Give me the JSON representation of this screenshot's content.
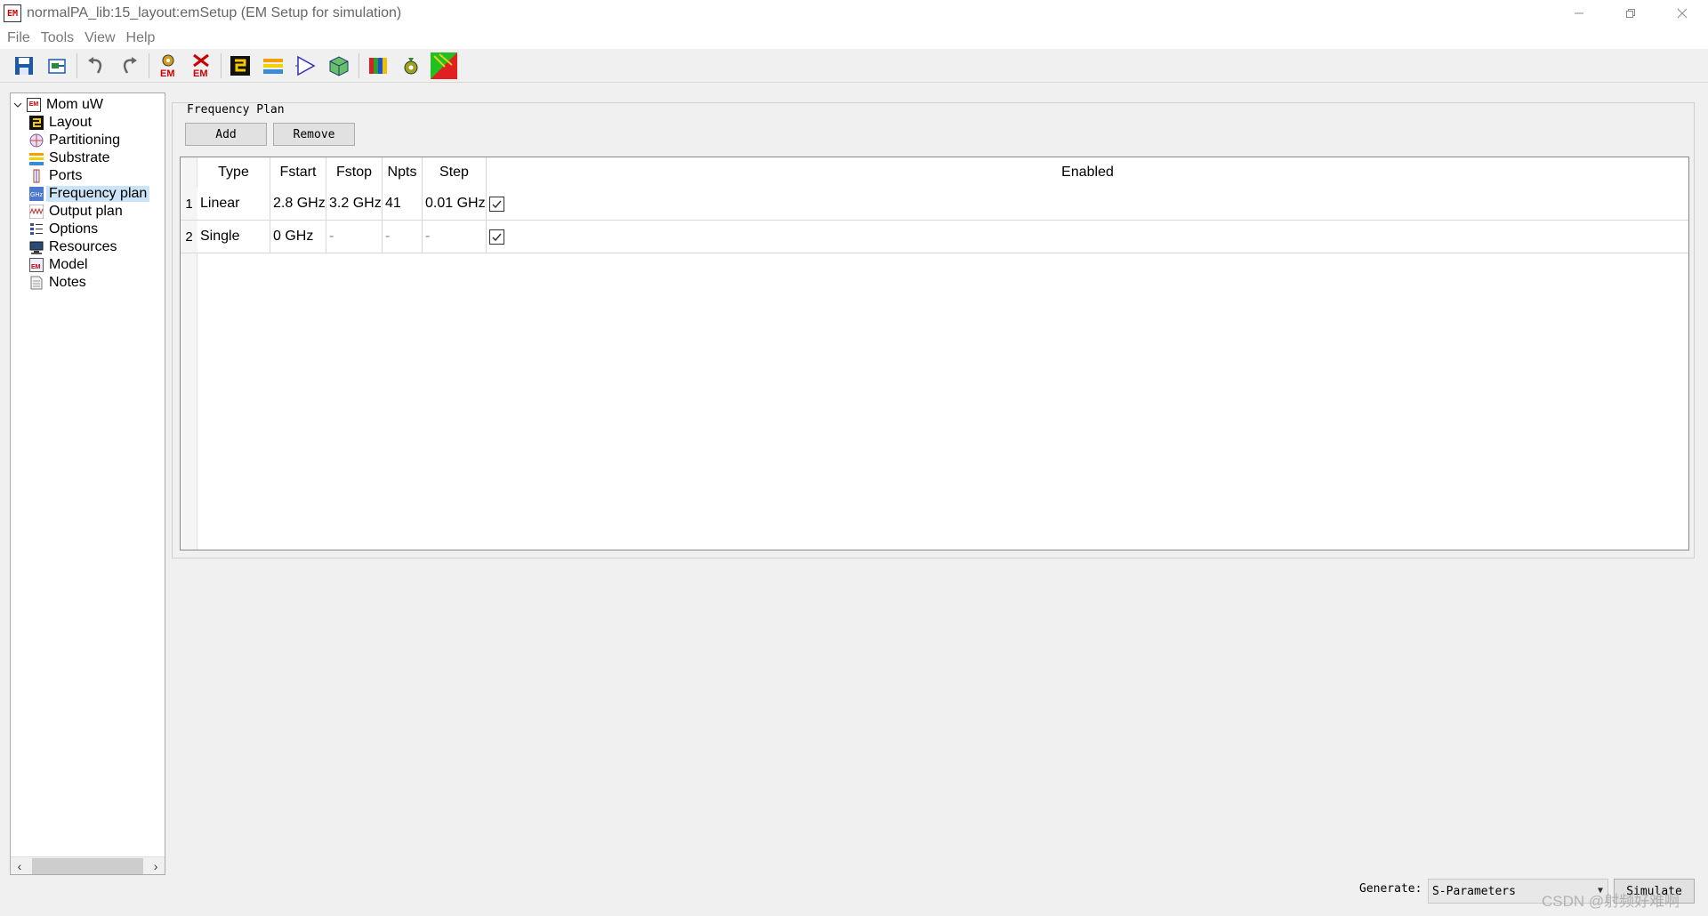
{
  "window": {
    "title": "normalPA_lib:15_layout:emSetup (EM Setup for simulation)",
    "app_icon": "EM",
    "controls": [
      "minimize-icon",
      "restore-icon",
      "close-icon"
    ]
  },
  "menu": {
    "items": [
      "File",
      "Tools",
      "View",
      "Help"
    ]
  },
  "toolbar": {
    "icons": [
      "save-icon",
      "export-icon",
      "undo-icon",
      "redo-icon",
      "em-settings-icon",
      "em-simulate-icon",
      "layout-icon",
      "substrate-icon",
      "ports-icon",
      "box-icon",
      "colors-icon",
      "gear-run-icon",
      "visualization-icon"
    ],
    "em_label": "EM"
  },
  "tree": {
    "root": "Mom uW",
    "items": [
      {
        "label": "Layout",
        "icon": "layout-icon"
      },
      {
        "label": "Partitioning",
        "icon": "partitioning-icon"
      },
      {
        "label": "Substrate",
        "icon": "substrate-icon"
      },
      {
        "label": "Ports",
        "icon": "ports-icon"
      },
      {
        "label": "Frequency plan",
        "icon": "frequency-plan-icon",
        "selected": true
      },
      {
        "label": "Output plan",
        "icon": "output-plan-icon"
      },
      {
        "label": "Options",
        "icon": "options-icon"
      },
      {
        "label": "Resources",
        "icon": "resources-icon"
      },
      {
        "label": "Model",
        "icon": "model-icon"
      },
      {
        "label": "Notes",
        "icon": "notes-icon"
      }
    ]
  },
  "panel": {
    "title": "Frequency Plan",
    "add_label": "Add",
    "remove_label": "Remove"
  },
  "table": {
    "columns": [
      "Type",
      "Fstart",
      "Fstop",
      "Npts",
      "Step",
      "Enabled"
    ],
    "rows": [
      {
        "num": "1",
        "type": "Linear",
        "fstart": "2.8 GHz",
        "fstop": "3.2 GHz",
        "npts": "41",
        "step": "0.01 GHz",
        "enabled": true
      },
      {
        "num": "2",
        "type": "Single",
        "fstart": "0 GHz",
        "fstop": "-",
        "npts": "-",
        "step": "-",
        "enabled": true
      }
    ]
  },
  "footer": {
    "generate_label": "Generate:",
    "generate_value": "S-Parameters",
    "simulate_label": "Simulate",
    "watermark": "CSDN @射频好难啊"
  }
}
